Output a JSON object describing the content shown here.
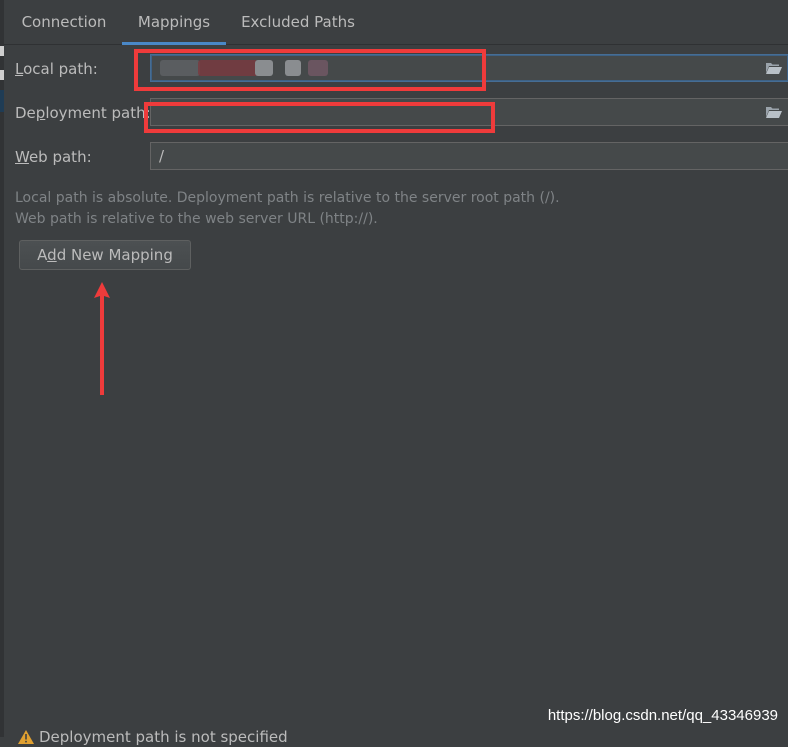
{
  "tabs": [
    {
      "label": "Connection"
    },
    {
      "label": "Mappings",
      "active": true
    },
    {
      "label": "Excluded Paths"
    }
  ],
  "fields": {
    "local_path": {
      "label_mnemonic": "L",
      "label_rest": "ocal path:",
      "value": ""
    },
    "deployment_path": {
      "label_pre": "De",
      "label_mnemonic": "p",
      "label_rest": "loyment path:",
      "value": ""
    },
    "web_path": {
      "label_mnemonic": "W",
      "label_rest": "eb path:",
      "value": "/"
    }
  },
  "hints": {
    "line1": "Local path is absolute. Deployment path is relative to the server root path (/).",
    "line2": "Web path is relative to the web server URL (http://)."
  },
  "add_button": {
    "pre": "A",
    "mnemonic": "d",
    "rest": "d New Mapping"
  },
  "warning": {
    "text": "Deployment path is not specified",
    "icon": "warning-icon"
  },
  "watermark": "https://blog.csdn.net/qq_43346939",
  "colors": {
    "background": "#3c3f41",
    "accent": "#4a88c7",
    "annotation_red": "#ef3b3b",
    "field_bg": "#45494a"
  },
  "icons": {
    "browse": "folder-open-icon",
    "annotation": "up-arrow-icon"
  }
}
